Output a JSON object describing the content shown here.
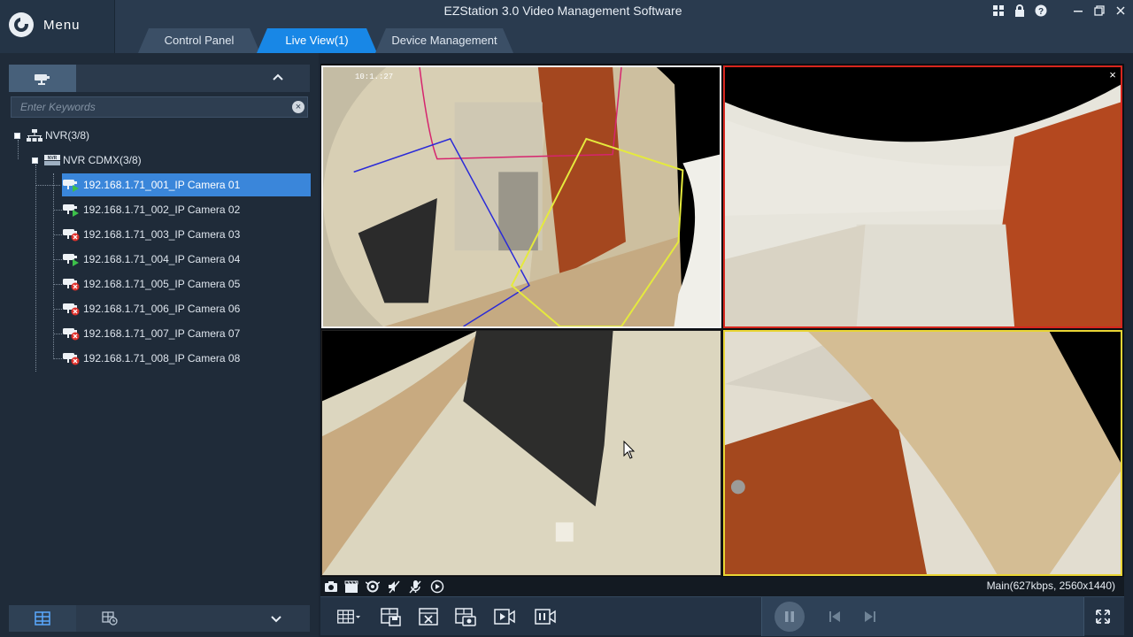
{
  "app": {
    "title": "EZStation 3.0 Video Management Software",
    "menu_label": "Menu"
  },
  "tabs": [
    {
      "label": "Control Panel",
      "active": false
    },
    {
      "label": "Live View(1)",
      "active": true
    },
    {
      "label": "Device Management",
      "active": false
    }
  ],
  "sidebar": {
    "search_placeholder": "Enter Keywords",
    "tree": {
      "root": {
        "label": "NVR(3/8)"
      },
      "device": {
        "label": "NVR CDMX(3/8)",
        "badge": "NVR"
      },
      "cameras": [
        {
          "label": "192.168.1.71_001_IP Camera 01",
          "status": "online-live",
          "selected": true
        },
        {
          "label": "192.168.1.71_002_IP Camera 02",
          "status": "online",
          "selected": false
        },
        {
          "label": "192.168.1.71_003_IP Camera 03",
          "status": "offline",
          "selected": false
        },
        {
          "label": "192.168.1.71_004_IP Camera 04",
          "status": "online",
          "selected": false
        },
        {
          "label": "192.168.1.71_005_IP Camera 05",
          "status": "offline",
          "selected": false
        },
        {
          "label": "192.168.1.71_006_IP Camera 06",
          "status": "offline",
          "selected": false
        },
        {
          "label": "192.168.1.71_007_IP Camera 07",
          "status": "offline",
          "selected": false
        },
        {
          "label": "192.168.1.71_008_IP Camera 08",
          "status": "offline",
          "selected": false
        }
      ]
    }
  },
  "video": {
    "timestamp": "10:1.:27",
    "stream_info": "Main(627kbps, 2560x1440)"
  },
  "colors": {
    "accent": "#1887e6",
    "selected_row": "#3a86da",
    "pane_active_border": "#d7261e",
    "pane_focus_border": "#e9d534",
    "online": "#3cc04a",
    "offline": "#e0312b"
  },
  "icons": {
    "window": [
      "layout-icon",
      "lock-icon",
      "help-icon",
      "minimize-icon",
      "restore-icon",
      "close-icon"
    ],
    "pane_toolbar": [
      "snapshot-icon",
      "record-icon",
      "digital-zoom-icon",
      "audio-off-icon",
      "talk-off-icon",
      "playback-icon"
    ],
    "bottom_toolbar": [
      "window-split-icon",
      "save-view-icon",
      "close-all-icon",
      "snapshot-all-icon",
      "record-all-icon",
      "stop-record-icon",
      "pause-icon",
      "prev-icon",
      "next-icon",
      "fullscreen-icon"
    ]
  }
}
